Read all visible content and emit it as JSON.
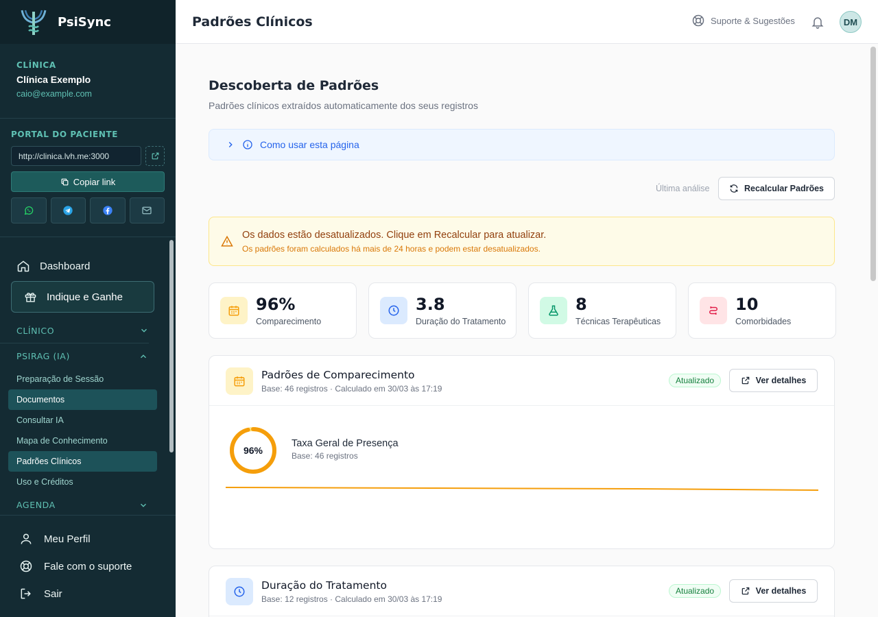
{
  "app": {
    "name": "PsiSync"
  },
  "clinic": {
    "label": "CLÍNICA",
    "name": "Clínica Exemplo",
    "email": "caio@example.com"
  },
  "portal": {
    "label": "PORTAL DO PACIENTE",
    "url": "http://clinica.lvh.me:3000",
    "copy_label": "Copiar link",
    "share": [
      "whatsapp-icon",
      "telegram-icon",
      "facebook-icon",
      "mail-icon"
    ]
  },
  "nav": {
    "dashboard": "Dashboard",
    "indique": "Indique e Ganhe",
    "groups": {
      "clinico": "CLÍNICO",
      "psirag": "PSIRAG (IA)",
      "agenda": "AGENDA"
    },
    "psirag_items": [
      {
        "label": "Preparação de Sessão"
      },
      {
        "label": "Documentos"
      },
      {
        "label": "Consultar IA"
      },
      {
        "label": "Mapa de Conhecimento"
      },
      {
        "label": "Padrões Clínicos"
      },
      {
        "label": "Uso e Créditos"
      }
    ],
    "bottom": [
      "Meu Perfil",
      "Fale com o suporte",
      "Sair"
    ]
  },
  "header": {
    "title": "Padrões Clínicos",
    "support": "Suporte & Sugestões",
    "avatar": "DM"
  },
  "main": {
    "title": "Descoberta de Padrões",
    "subtitle": "Padrões clínicos extraídos automaticamente dos seus registros",
    "howto": "Como usar esta página",
    "last_analysis": "Última análise",
    "recalc": "Recalcular Padrões",
    "warning": {
      "title": "Os dados estão desatualizados. Clique em Recalcular para atualizar.",
      "desc": "Os padrões foram calculados há mais de 24 horas e podem estar desatualizados."
    },
    "stats": [
      {
        "value": "96%",
        "label": "Comparecimento",
        "icon": "calendar-icon"
      },
      {
        "value": "3.8",
        "label": "Duração do Tratamento",
        "icon": "clock-icon"
      },
      {
        "value": "8",
        "label": "Técnicas Terapêuticas",
        "icon": "flask-icon"
      },
      {
        "value": "10",
        "label": "Comorbidades",
        "icon": "link-icon"
      }
    ],
    "cards": [
      {
        "title": "Padrões de Comparecimento",
        "meta": "Base: 46 registros · Calculado em 30/03 às 17:19",
        "badge": "Atualizado",
        "details": "Ver detalhes",
        "rate_value": "96%",
        "rate_percent": 96,
        "rate_title": "Taxa Geral de Presença",
        "rate_base": "Base: 46 registros"
      },
      {
        "title": "Duração do Tratamento",
        "meta": "Base: 12 registros · Calculado em 30/03 às 17:19",
        "badge": "Atualizado",
        "details": "Ver detalhes"
      }
    ]
  },
  "colors": {
    "accent": "#1d5b5b",
    "sidebar": "#142b33",
    "amber": "#f59e0b",
    "blue": "#2563eb",
    "green": "#15803d"
  }
}
